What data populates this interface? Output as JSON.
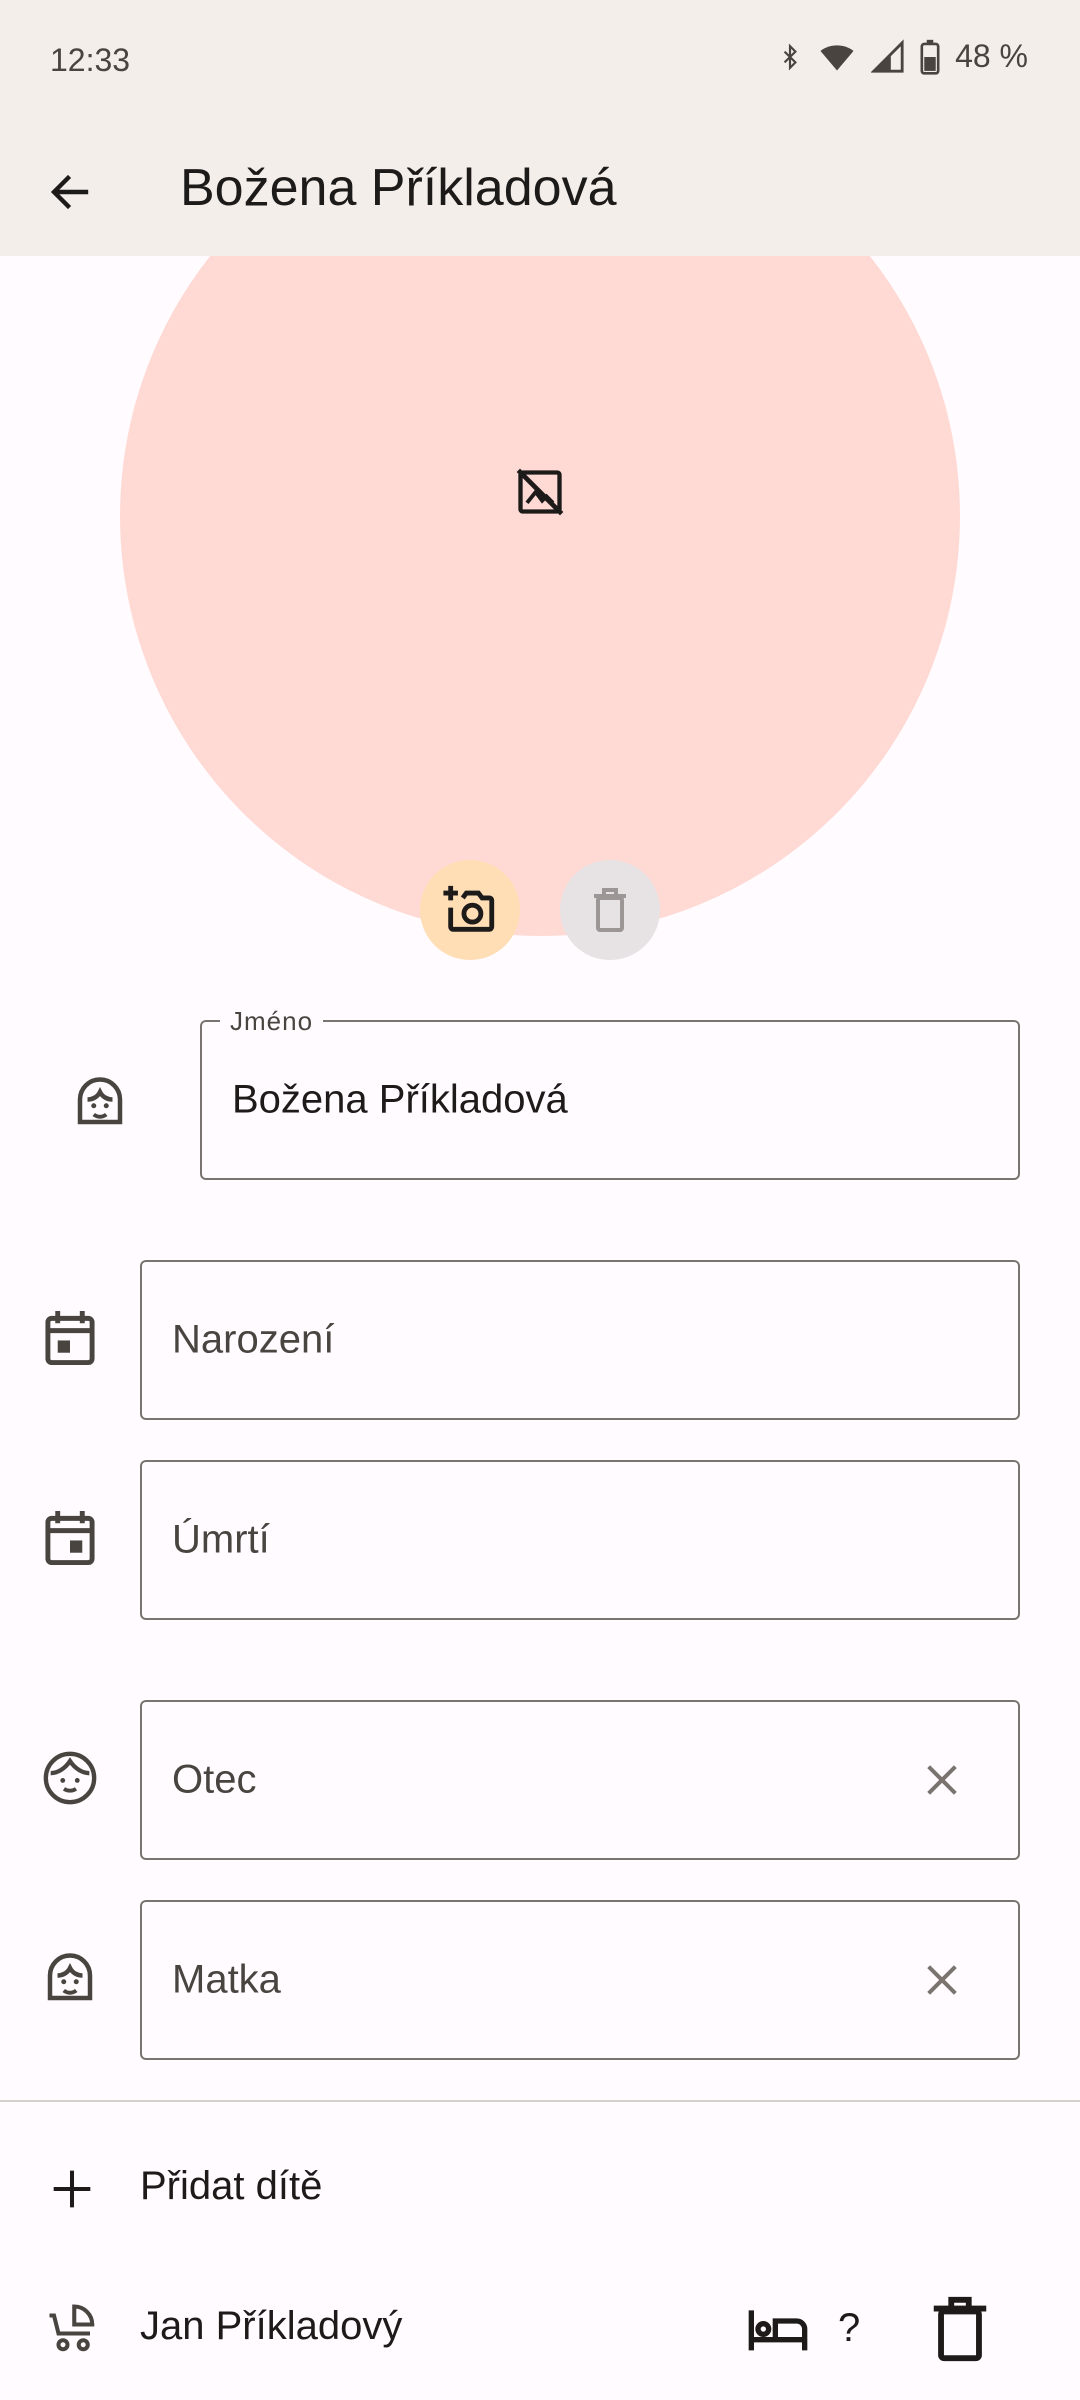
{
  "status_bar": {
    "time": "12:33",
    "battery": "48 %"
  },
  "app_bar": {
    "title": "Božena Příkladová"
  },
  "photo": {
    "background_color": "#ffdad4"
  },
  "form": {
    "name": {
      "label": "Jméno",
      "value": "Božena Příkladová"
    },
    "birth": {
      "placeholder": "Narození"
    },
    "death": {
      "placeholder": "Úmrtí"
    },
    "father": {
      "placeholder": "Otec"
    },
    "mother": {
      "placeholder": "Matka"
    }
  },
  "children": {
    "add_label": "Přidat dítě",
    "items": [
      {
        "name": "Jan Příkladový",
        "status": "?"
      }
    ]
  }
}
